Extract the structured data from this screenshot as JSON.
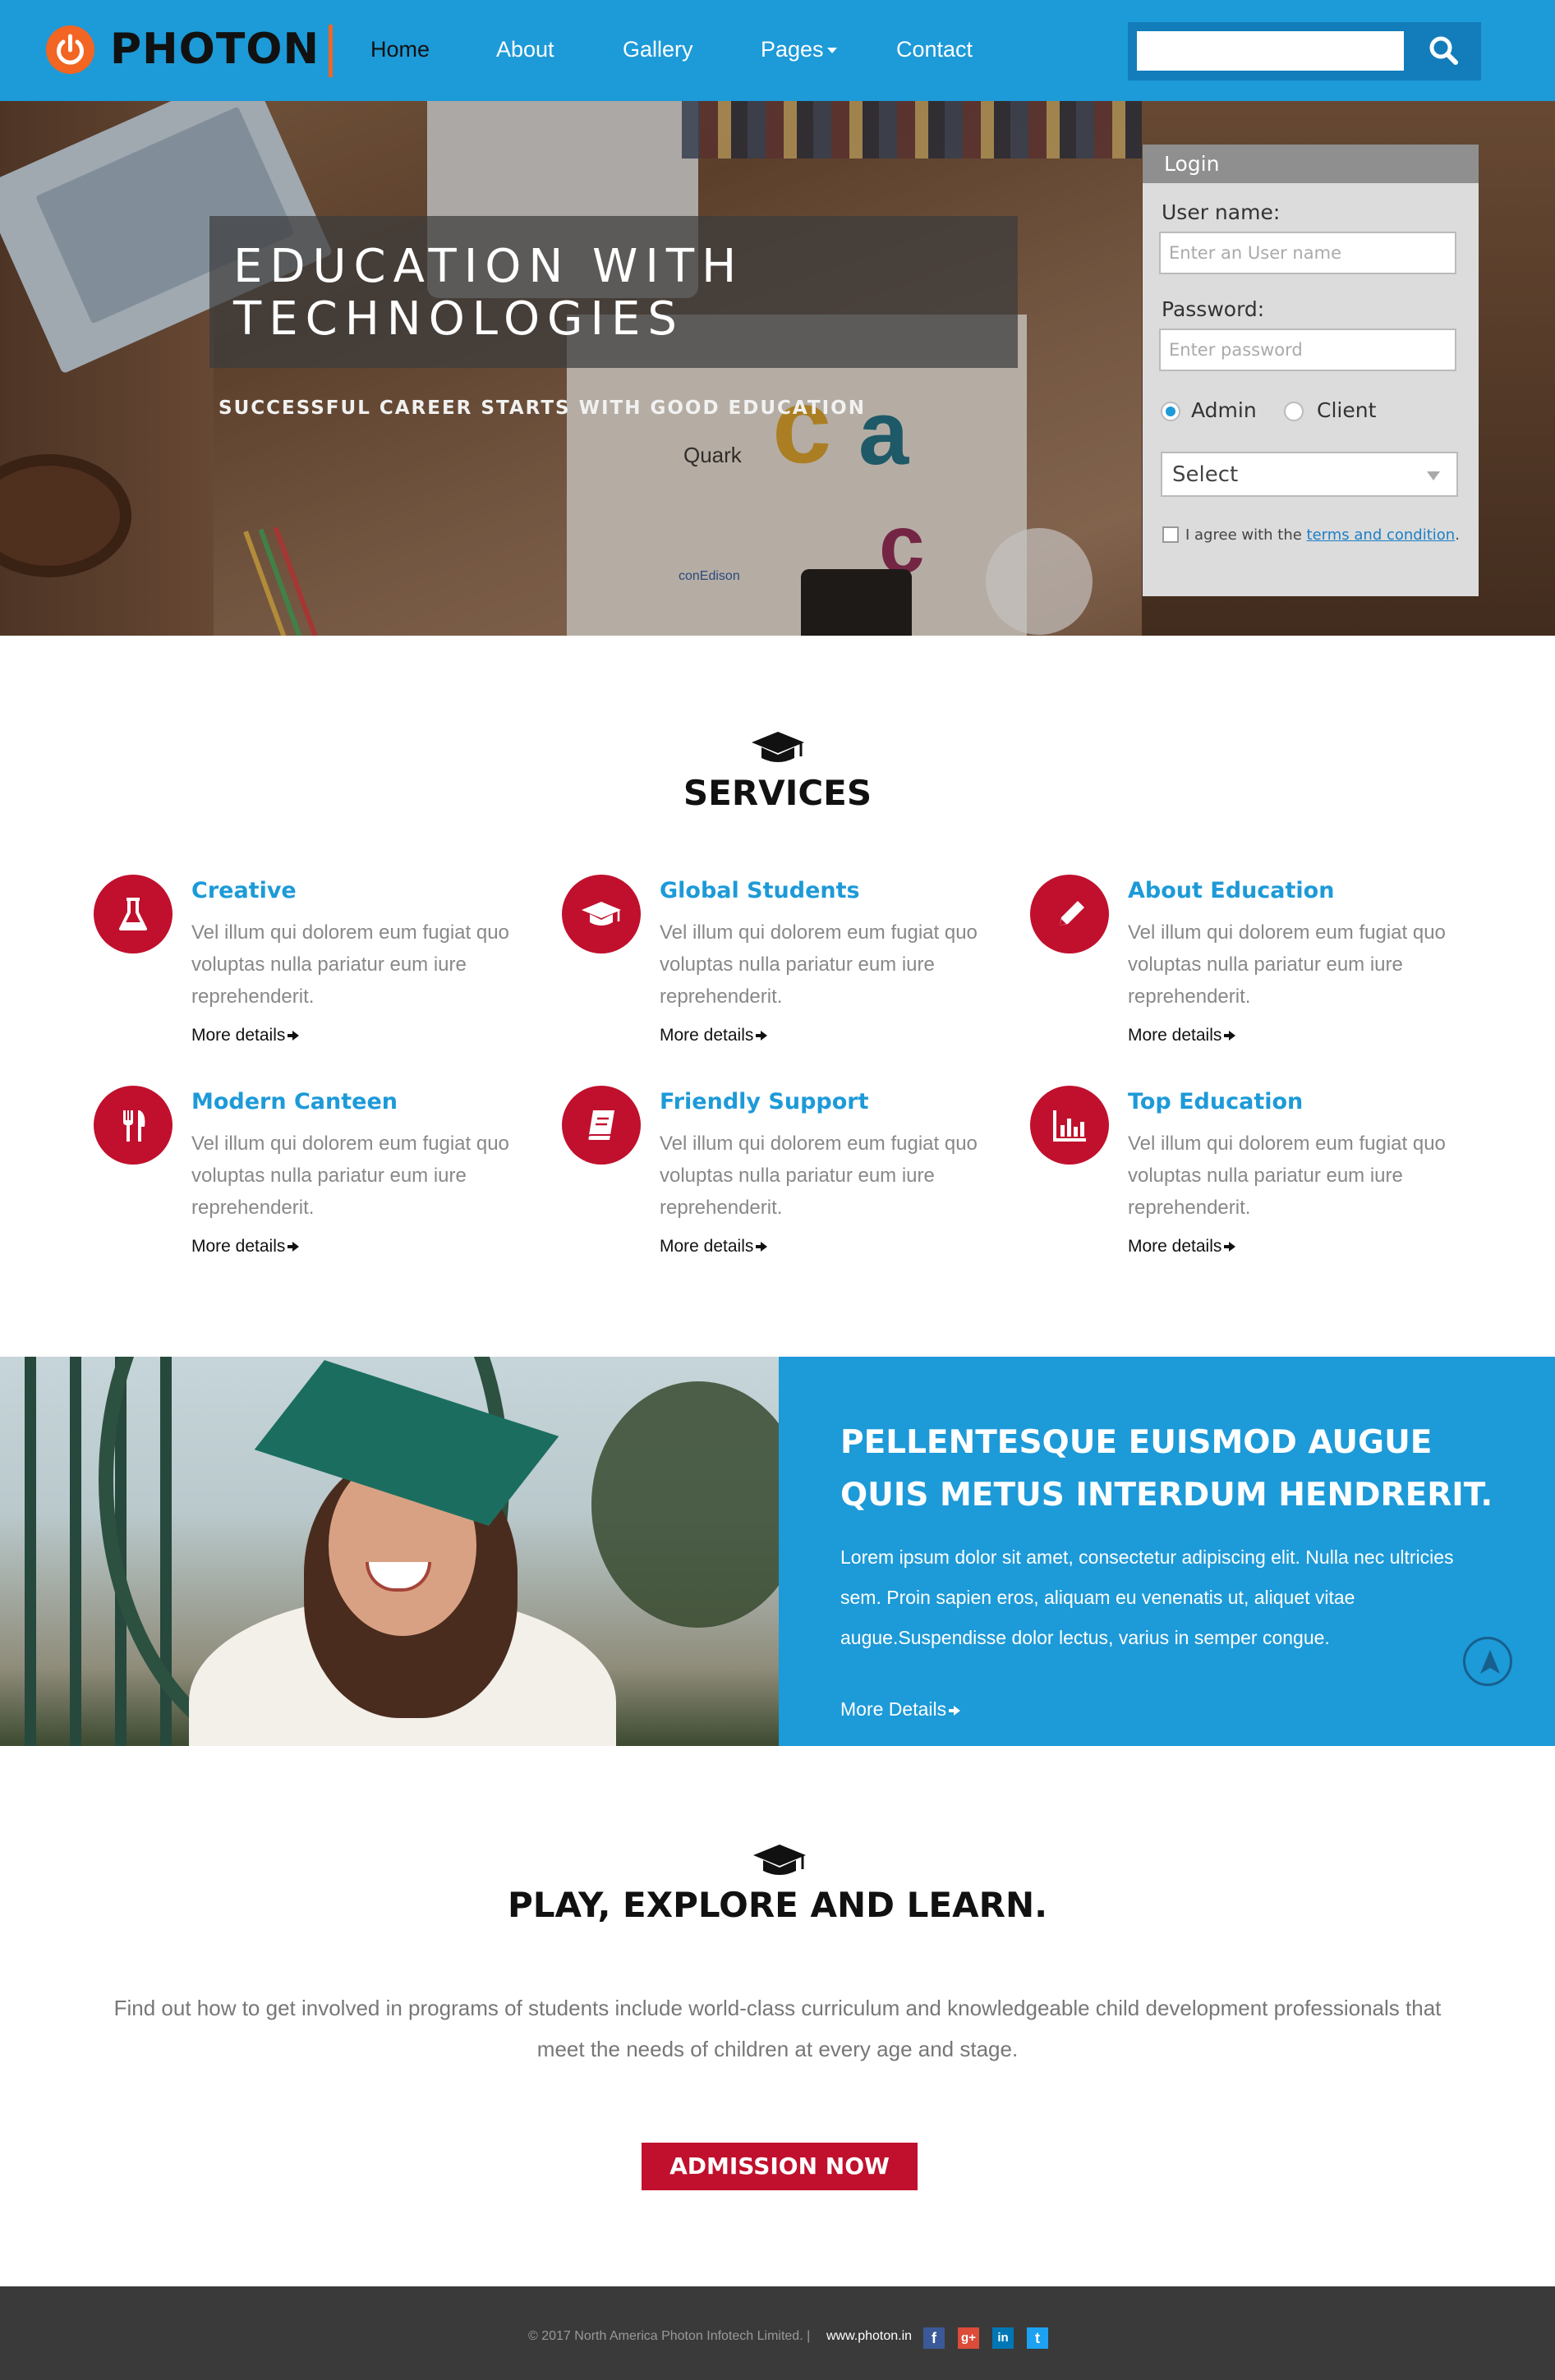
{
  "nav": {
    "logo_text": "PHOTON",
    "items": [
      {
        "label": "Home"
      },
      {
        "label": "About"
      },
      {
        "label": "Gallery"
      },
      {
        "label": "Pages"
      },
      {
        "label": "Contact"
      }
    ],
    "search": {
      "value": "",
      "placeholder": ""
    }
  },
  "hero": {
    "title": "EDUCATION WITH TECHNOLOGIES",
    "subtitle": "SUCCESSFUL CAREER STARTS WITH GOOD EDUCATION",
    "decor": {
      "quark": "Quark",
      "con_edison": "conEdison",
      "letter_a": "a",
      "letter_c": "c",
      "letter_big_c": "c"
    }
  },
  "login": {
    "title": "Login",
    "username_label": "User name:",
    "username_placeholder": "Enter an User name",
    "password_label": "Password:",
    "password_placeholder": "Enter password",
    "roles": [
      {
        "label": "Admin",
        "selected": true
      },
      {
        "label": "Client",
        "selected": false
      }
    ],
    "select_value": "Select",
    "agree_text": "I agree with the",
    "agree_link": "terms and condition",
    "agree_tail": "."
  },
  "services": {
    "title": "SERVICES",
    "items": [
      {
        "title": "Creative",
        "icon": "flask-icon",
        "text": "Vel illum qui dolorem eum fugiat quo voluptas nulla pariatur eum iure reprehenderit.",
        "more": "More details"
      },
      {
        "title": "Global Students",
        "icon": "graduation-cap-icon",
        "text": "Vel illum qui dolorem eum fugiat quo voluptas nulla pariatur eum iure reprehenderit.",
        "more": "More details"
      },
      {
        "title": "About Education",
        "icon": "pencil-icon",
        "text": "Vel illum qui dolorem eum fugiat quo voluptas nulla pariatur eum iure reprehenderit.",
        "more": "More details"
      },
      {
        "title": "Modern Canteen",
        "icon": "cutlery-icon",
        "text": "Vel illum qui dolorem eum fugiat quo voluptas nulla pariatur eum iure reprehenderit.",
        "more": "More details"
      },
      {
        "title": "Friendly Support",
        "icon": "book-icon",
        "text": "Vel illum qui dolorem eum fugiat quo voluptas nulla pariatur eum iure reprehenderit.",
        "more": "More details"
      },
      {
        "title": "Top Education",
        "icon": "bar-chart-icon",
        "text": "Vel illum qui dolorem eum fugiat quo voluptas nulla pariatur eum iure reprehenderit.",
        "more": "More details"
      }
    ]
  },
  "feature": {
    "title": "PELLENTESQUE EUISMOD AUGUE QUIS METUS INTERDUM HENDRERIT.",
    "text": "Lorem ipsum dolor sit amet, consectetur adipiscing elit. Nulla nec ultricies sem. Proin sapien eros, aliquam eu venenatis ut, aliquet vitae augue.Suspendisse dolor lectus, varius in semper congue.",
    "more": "More Details"
  },
  "play": {
    "title": "PLAY, EXPLORE AND LEARN.",
    "text": "Find out how to get involved in programs of students include world-class curriculum and knowledgeable child development professionals that meet the needs of children at every age and stage.",
    "button": "ADMISSION NOW"
  },
  "footer": {
    "copyright": "© 2017 North America Photon Infotech Limited. |",
    "link": "www.photon.in",
    "social": [
      {
        "name": "facebook-icon",
        "glyph": "f",
        "color": "#3b5998"
      },
      {
        "name": "google-plus-icon",
        "glyph": "g+",
        "color": "#dd4b39"
      },
      {
        "name": "linkedin-icon",
        "glyph": "in",
        "color": "#0077b5"
      },
      {
        "name": "twitter-icon",
        "glyph": "t",
        "color": "#1da1f2"
      }
    ]
  },
  "colors": {
    "brand_blue": "#1d9ad8",
    "accent_red": "#c0102d",
    "logo_orange": "#f26522",
    "footer_bg": "#3a3a3a"
  }
}
